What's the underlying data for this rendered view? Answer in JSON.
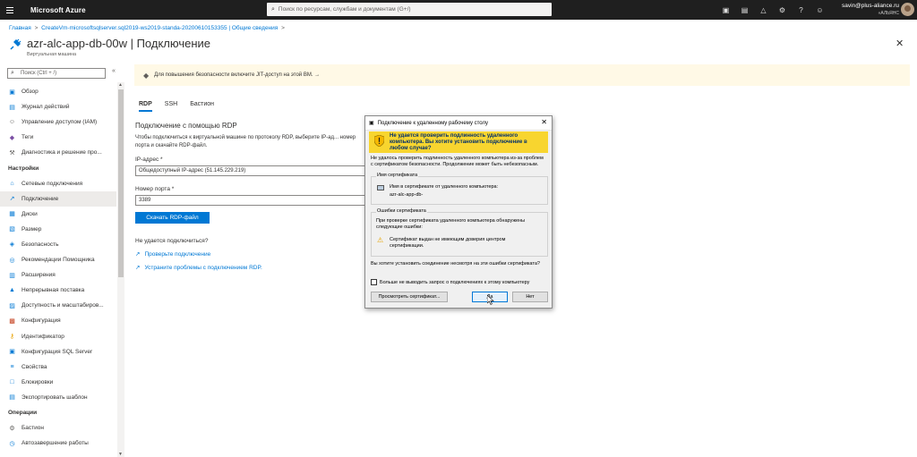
{
  "topbar": {
    "brand": "Microsoft Azure",
    "search_placeholder": "Поиск по ресурсам, службам и документам (G+/)",
    "user_email": "savin@plus-aliance.ru",
    "user_org": "«АЛЬЯНС",
    "icons": [
      "cloud-shell-icon",
      "directory-icon",
      "bell-icon",
      "gear-icon",
      "help-icon",
      "feedback-icon"
    ]
  },
  "breadcrumb": {
    "items": [
      "Главная",
      "CreateVm-microsoftsqlserver.sql2019-ws2019-standa-20200610153355 | Общие сведения"
    ],
    "separator": ">"
  },
  "header": {
    "title": "azr-alc-app-db-00w | Подключение",
    "subtitle": "Виртуальная машина"
  },
  "sidebar": {
    "search_placeholder": "Поиск (Ctrl + /)",
    "collapse": "«",
    "items": [
      {
        "label": "Обзор",
        "icon": "monitor-icon",
        "color": "#0078d4"
      },
      {
        "label": "Журнал действий",
        "icon": "log-icon",
        "color": "#0078d4"
      },
      {
        "label": "Управление доступом (IAM)",
        "icon": "people-icon",
        "color": "#605e5c"
      },
      {
        "label": "Теги",
        "icon": "tag-icon",
        "color": "#7a4ea3"
      },
      {
        "label": "Диагностика и решение про...",
        "icon": "wrench-icon",
        "color": "#605e5c"
      }
    ],
    "section_settings": "Настройки",
    "settings_items": [
      {
        "label": "Сетевые подключения",
        "icon": "network-icon",
        "color": "#0078d4"
      },
      {
        "label": "Подключение",
        "icon": "connect-icon",
        "color": "#0078d4",
        "active": true
      },
      {
        "label": "Диски",
        "icon": "disk-icon",
        "color": "#0078d4"
      },
      {
        "label": "Размер",
        "icon": "size-icon",
        "color": "#0078d4"
      },
      {
        "label": "Безопасность",
        "icon": "shield-icon",
        "color": "#0078d4"
      },
      {
        "label": "Рекомендации Помощника",
        "icon": "advisor-icon",
        "color": "#0078d4"
      },
      {
        "label": "Расширения",
        "icon": "extension-icon",
        "color": "#0078d4"
      },
      {
        "label": "Непрерывная поставка",
        "icon": "rocket-icon",
        "color": "#0078d4"
      },
      {
        "label": "Доступность и масштабиров...",
        "icon": "scale-icon",
        "color": "#0078d4"
      },
      {
        "label": "Конфигурация",
        "icon": "config-icon",
        "color": "#c43e1c"
      },
      {
        "label": "Идентификатор",
        "icon": "key-icon",
        "color": "#e8a000"
      },
      {
        "label": "Конфигурация SQL Server",
        "icon": "sql-icon",
        "color": "#0078d4"
      },
      {
        "label": "Свойства",
        "icon": "properties-icon",
        "color": "#0078d4"
      },
      {
        "label": "Блокировки",
        "icon": "lock-icon",
        "color": "#0078d4"
      },
      {
        "label": "Экспортировать шаблон",
        "icon": "export-icon",
        "color": "#0078d4"
      }
    ],
    "section_operations": "Операции",
    "operations_items": [
      {
        "label": "Бастион",
        "icon": "bastion-icon",
        "color": "#605e5c"
      },
      {
        "label": "Автозавершение работы",
        "icon": "clock-icon",
        "color": "#0078d4"
      }
    ]
  },
  "banner": {
    "text": "Для повышения безопасности включите JIT-доступ на этой ВМ. →"
  },
  "tabs": [
    "RDP",
    "SSH",
    "Бастион"
  ],
  "rdp": {
    "title": "Подключение с помощью RDP",
    "description": "Чтобы подключиться к виртуальной машине по протоколу RDP, выберите IP-ад... номер порта и скачайте RDP-файл.",
    "ip_label": "IP-адрес *",
    "ip_value": "Общедоступный IP-адрес (51.145.229.219)",
    "port_label": "Номер порта *",
    "port_value": "3389",
    "download_button": "Скачать RDP-файл",
    "cant_connect": "Не удается подключиться?",
    "link_check": "Проверьте подключение",
    "link_troubleshoot": "Устраните проблемы с подключением RDP."
  },
  "dialog": {
    "title": "Подключение к удаленному рабочему столу",
    "warning": "Не удается проверить подлинность удаленного компьютера. Вы хотите установить подключение в любом случае?",
    "text": "Не удалось проверить подлинность удаленного компьютера из-за проблем с сертификатом безопасности. Продолжение может быть небезопасным.",
    "cert_name_group": "Имя сертификата",
    "cert_name_line1": "Имя в сертификате от удаленного компьютера:",
    "cert_name_line2": "azr-alc-app-db-",
    "cert_errors_group": "Ошибки сертификата",
    "cert_errors_text": "При проверке сертификата удаленного компьютера обнаружены следующие ошибки:",
    "cert_error_item": "Сертификат выдан не имеющим доверия центром сертификации.",
    "question": "Вы хотите установить соединение несмотря на эти ошибки сертификата?",
    "checkbox": "Больше не выводить запрос о подключениях к этому компьютеру",
    "view_cert_button": "Просмотреть сертификат...",
    "yes_button": "Да",
    "no_button": "Нет"
  }
}
